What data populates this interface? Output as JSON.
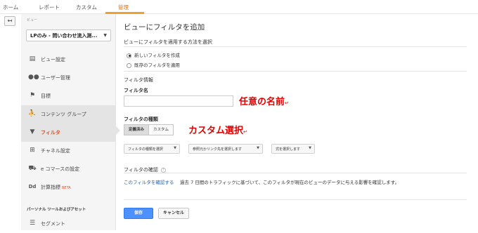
{
  "topnav": {
    "tabs": [
      {
        "label": "ホーム"
      },
      {
        "label": "レポート"
      },
      {
        "label": "カスタム"
      },
      {
        "label": "管理"
      }
    ],
    "active_tab": "管理"
  },
  "sidebar": {
    "view_label": "ビュー",
    "view_select": "LPのみ - 問い合わせ流入測...",
    "items": [
      {
        "label": "ビュー設定",
        "icon": "document-icon"
      },
      {
        "label": "ユーザー管理",
        "icon": "users-icon"
      },
      {
        "label": "目標",
        "icon": "flag-icon"
      },
      {
        "label": "コンテンツ グループ",
        "icon": "person-icon"
      },
      {
        "label": "フィルタ",
        "icon": "filter-icon"
      },
      {
        "label": "チャネル設定",
        "icon": "channel-icon"
      },
      {
        "label": "e コマースの設定",
        "icon": "cart-icon"
      },
      {
        "label": "計算指標",
        "icon": "dd-icon",
        "badge": "BETA"
      }
    ],
    "section_header": "パーソナル ツールおよびアセット",
    "bottom_item": {
      "label": "セグメント",
      "icon": "segment-icon"
    }
  },
  "main": {
    "title": "ビューにフィルタを追加",
    "method_section": "ビューにフィルタを適用する方法を選択",
    "radio_new": "新しいフィルタを作成",
    "radio_existing": "既存のフィルタを適用",
    "filter_info": "フィルタ情報",
    "filter_name_label": "フィルタ名",
    "filter_name_value": "",
    "filter_type_label": "フィルタの種類",
    "type_predefined": "定義済み",
    "type_custom": "カスタム",
    "dropdown_type": "フィルタの種類を選択",
    "dropdown_source": "参照元かリンク先を選択します",
    "dropdown_expression": "式を選択します",
    "verify_label": "フィルタの確認",
    "verify_link": "このフィルタを確認する",
    "verify_text": "過去 7 日間のトラフィックに基づいて、このフィルタが現在のビューのデータに与える影響を確認します。",
    "save": "保存",
    "cancel": "キャンセル"
  },
  "annotations": {
    "name_note": "任意の名前",
    "custom_note": "カスタム選択",
    "return_mark": "↵"
  }
}
